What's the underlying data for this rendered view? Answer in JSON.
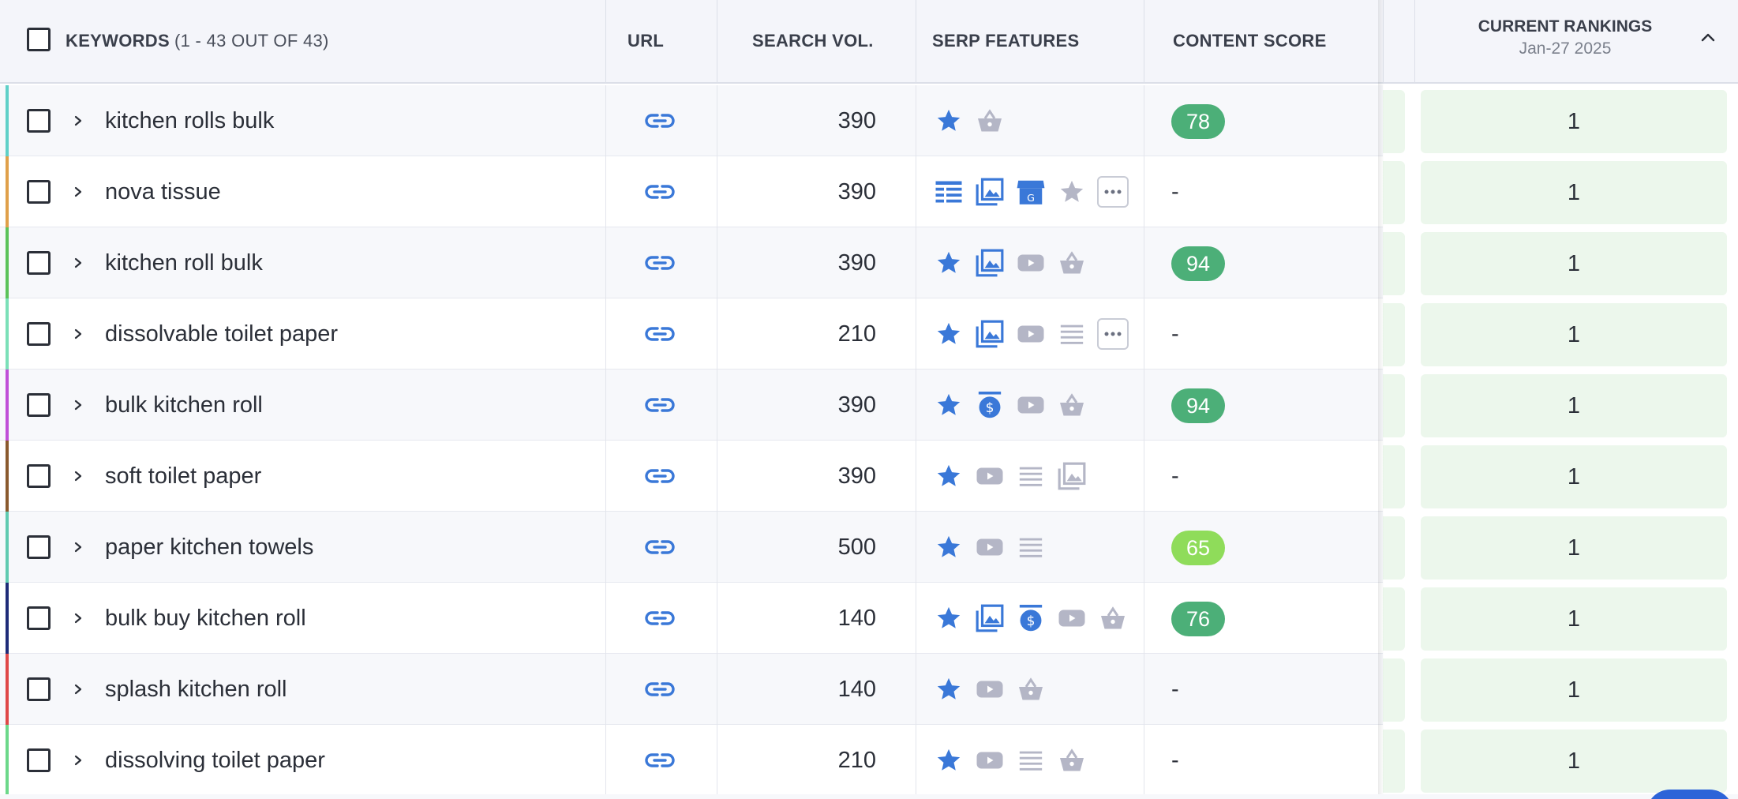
{
  "header": {
    "keywords_label": "KEYWORDS",
    "keywords_count": "(1 - 43 OUT OF 43)",
    "url_label": "URL",
    "search_vol_label": "SEARCH VOL.",
    "serp_features_label": "SERP FEATURES",
    "content_score_label": "CONTENT SCORE",
    "current_rankings_label": "CURRENT RANKINGS",
    "current_rankings_date": "Jan-27 2025"
  },
  "colors": {
    "accent_blue": "#3a78d8",
    "feature_gray": "#b4b6c6",
    "score_dark_green": "#4caf78",
    "score_light_green": "#8fdc5a",
    "rank_bg": "#ecf7ec"
  },
  "rows": [
    {
      "keyword": "kitchen rolls bulk",
      "bar_color": "#5fd0c8",
      "volume": "390",
      "serp": [
        "star-active",
        "basket"
      ],
      "score": "78",
      "score_color": "#4caf78",
      "rank": "1"
    },
    {
      "keyword": "nova tissue",
      "bar_color": "#e0a04a",
      "volume": "390",
      "serp": [
        "table-active",
        "images-active",
        "local-pack-active",
        "star",
        "more"
      ],
      "score": "-",
      "score_color": "",
      "rank": "1"
    },
    {
      "keyword": "kitchen roll bulk",
      "bar_color": "#5cc35a",
      "volume": "390",
      "serp": [
        "star-active",
        "images-active",
        "video",
        "basket"
      ],
      "score": "94",
      "score_color": "#4caf78",
      "rank": "1"
    },
    {
      "keyword": "dissolvable toilet paper",
      "bar_color": "#7be0b8",
      "volume": "210",
      "serp": [
        "star-active",
        "images-active",
        "video",
        "list",
        "more"
      ],
      "score": "-",
      "score_color": "",
      "rank": "1"
    },
    {
      "keyword": "bulk kitchen roll",
      "bar_color": "#c04fd8",
      "volume": "390",
      "serp": [
        "star-active",
        "ads-active",
        "video",
        "basket"
      ],
      "score": "94",
      "score_color": "#4caf78",
      "rank": "1"
    },
    {
      "keyword": "soft toilet paper",
      "bar_color": "#8a5a2e",
      "volume": "390",
      "serp": [
        "star-active",
        "video",
        "list",
        "images"
      ],
      "score": "-",
      "score_color": "",
      "rank": "1"
    },
    {
      "keyword": "paper kitchen towels",
      "bar_color": "#5fcab0",
      "volume": "500",
      "serp": [
        "star-active",
        "video",
        "list"
      ],
      "score": "65",
      "score_color": "#8fdc5a",
      "rank": "1"
    },
    {
      "keyword": "bulk buy kitchen roll",
      "bar_color": "#1e2b78",
      "volume": "140",
      "serp": [
        "star-active",
        "images-active",
        "ads-active",
        "video",
        "basket"
      ],
      "score": "76",
      "score_color": "#4caf78",
      "rank": "1"
    },
    {
      "keyword": "splash kitchen roll",
      "bar_color": "#e04848",
      "volume": "140",
      "serp": [
        "star-active",
        "video",
        "basket"
      ],
      "score": "-",
      "score_color": "",
      "rank": "1"
    },
    {
      "keyword": "dissolving toilet paper",
      "bar_color": "#6cd88a",
      "volume": "210",
      "serp": [
        "star-active",
        "video",
        "list",
        "basket"
      ],
      "score": "-",
      "score_color": "",
      "rank": "1"
    }
  ]
}
